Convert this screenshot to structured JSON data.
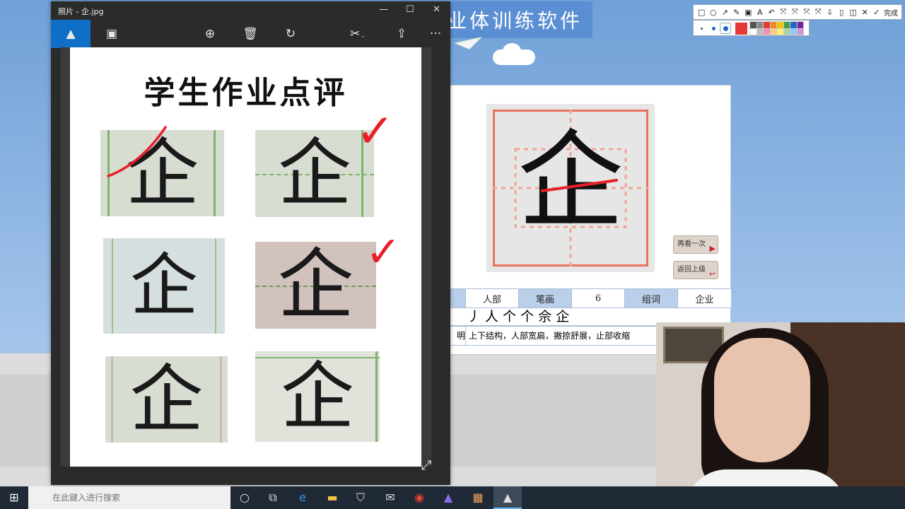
{
  "background_app": {
    "title": "业体训练软件",
    "character": "企",
    "buttons": {
      "replay": "再看一次",
      "back": "返回上级"
    },
    "table": {
      "radical_value": "人部",
      "strokes_label": "笔画",
      "strokes_value": "6",
      "words_label": "组词",
      "words_value": "企业"
    },
    "stroke_order": "丿 人 个 个 佘 企",
    "description_label": "明",
    "description": "上下结构，人部宽扁，撇捺舒展，止部收缩"
  },
  "annotation_toolbar": {
    "tools": [
      "□",
      "○",
      "↗",
      "✎",
      "▣",
      "A",
      "↶",
      "⤧",
      "⤧",
      "⤧",
      "⤧",
      "⇩",
      "▯",
      "◫",
      "✕",
      "✓"
    ],
    "done_label": "完成",
    "current_color": "#e53935",
    "swatches": [
      "#555555",
      "#888888",
      "#e53935",
      "#f08a24",
      "#f1c40f",
      "#43a047",
      "#1e66c8",
      "#7b1fa2",
      "#ffffff",
      "#bdbdbd",
      "#f48fb1",
      "#ffcc80",
      "#fff176",
      "#a5d6a7",
      "#90caf9",
      "#ce93d8"
    ]
  },
  "photo_viewer": {
    "window_title": "照片 - 企.jpg",
    "sheet_title": "学生作业点评",
    "sample_char": "企",
    "check_mark": "✓",
    "toolbar_icons": [
      "image-icon",
      "slideshow-icon",
      "zoom-icon",
      "delete-icon",
      "rotate-icon",
      "edit-icon",
      "share-icon",
      "more-icon"
    ],
    "colors": {
      "accent": "#0f6fc6",
      "mark_red": "#e8202a"
    }
  },
  "taskbar": {
    "search_placeholder": "在此键入进行搜索"
  }
}
